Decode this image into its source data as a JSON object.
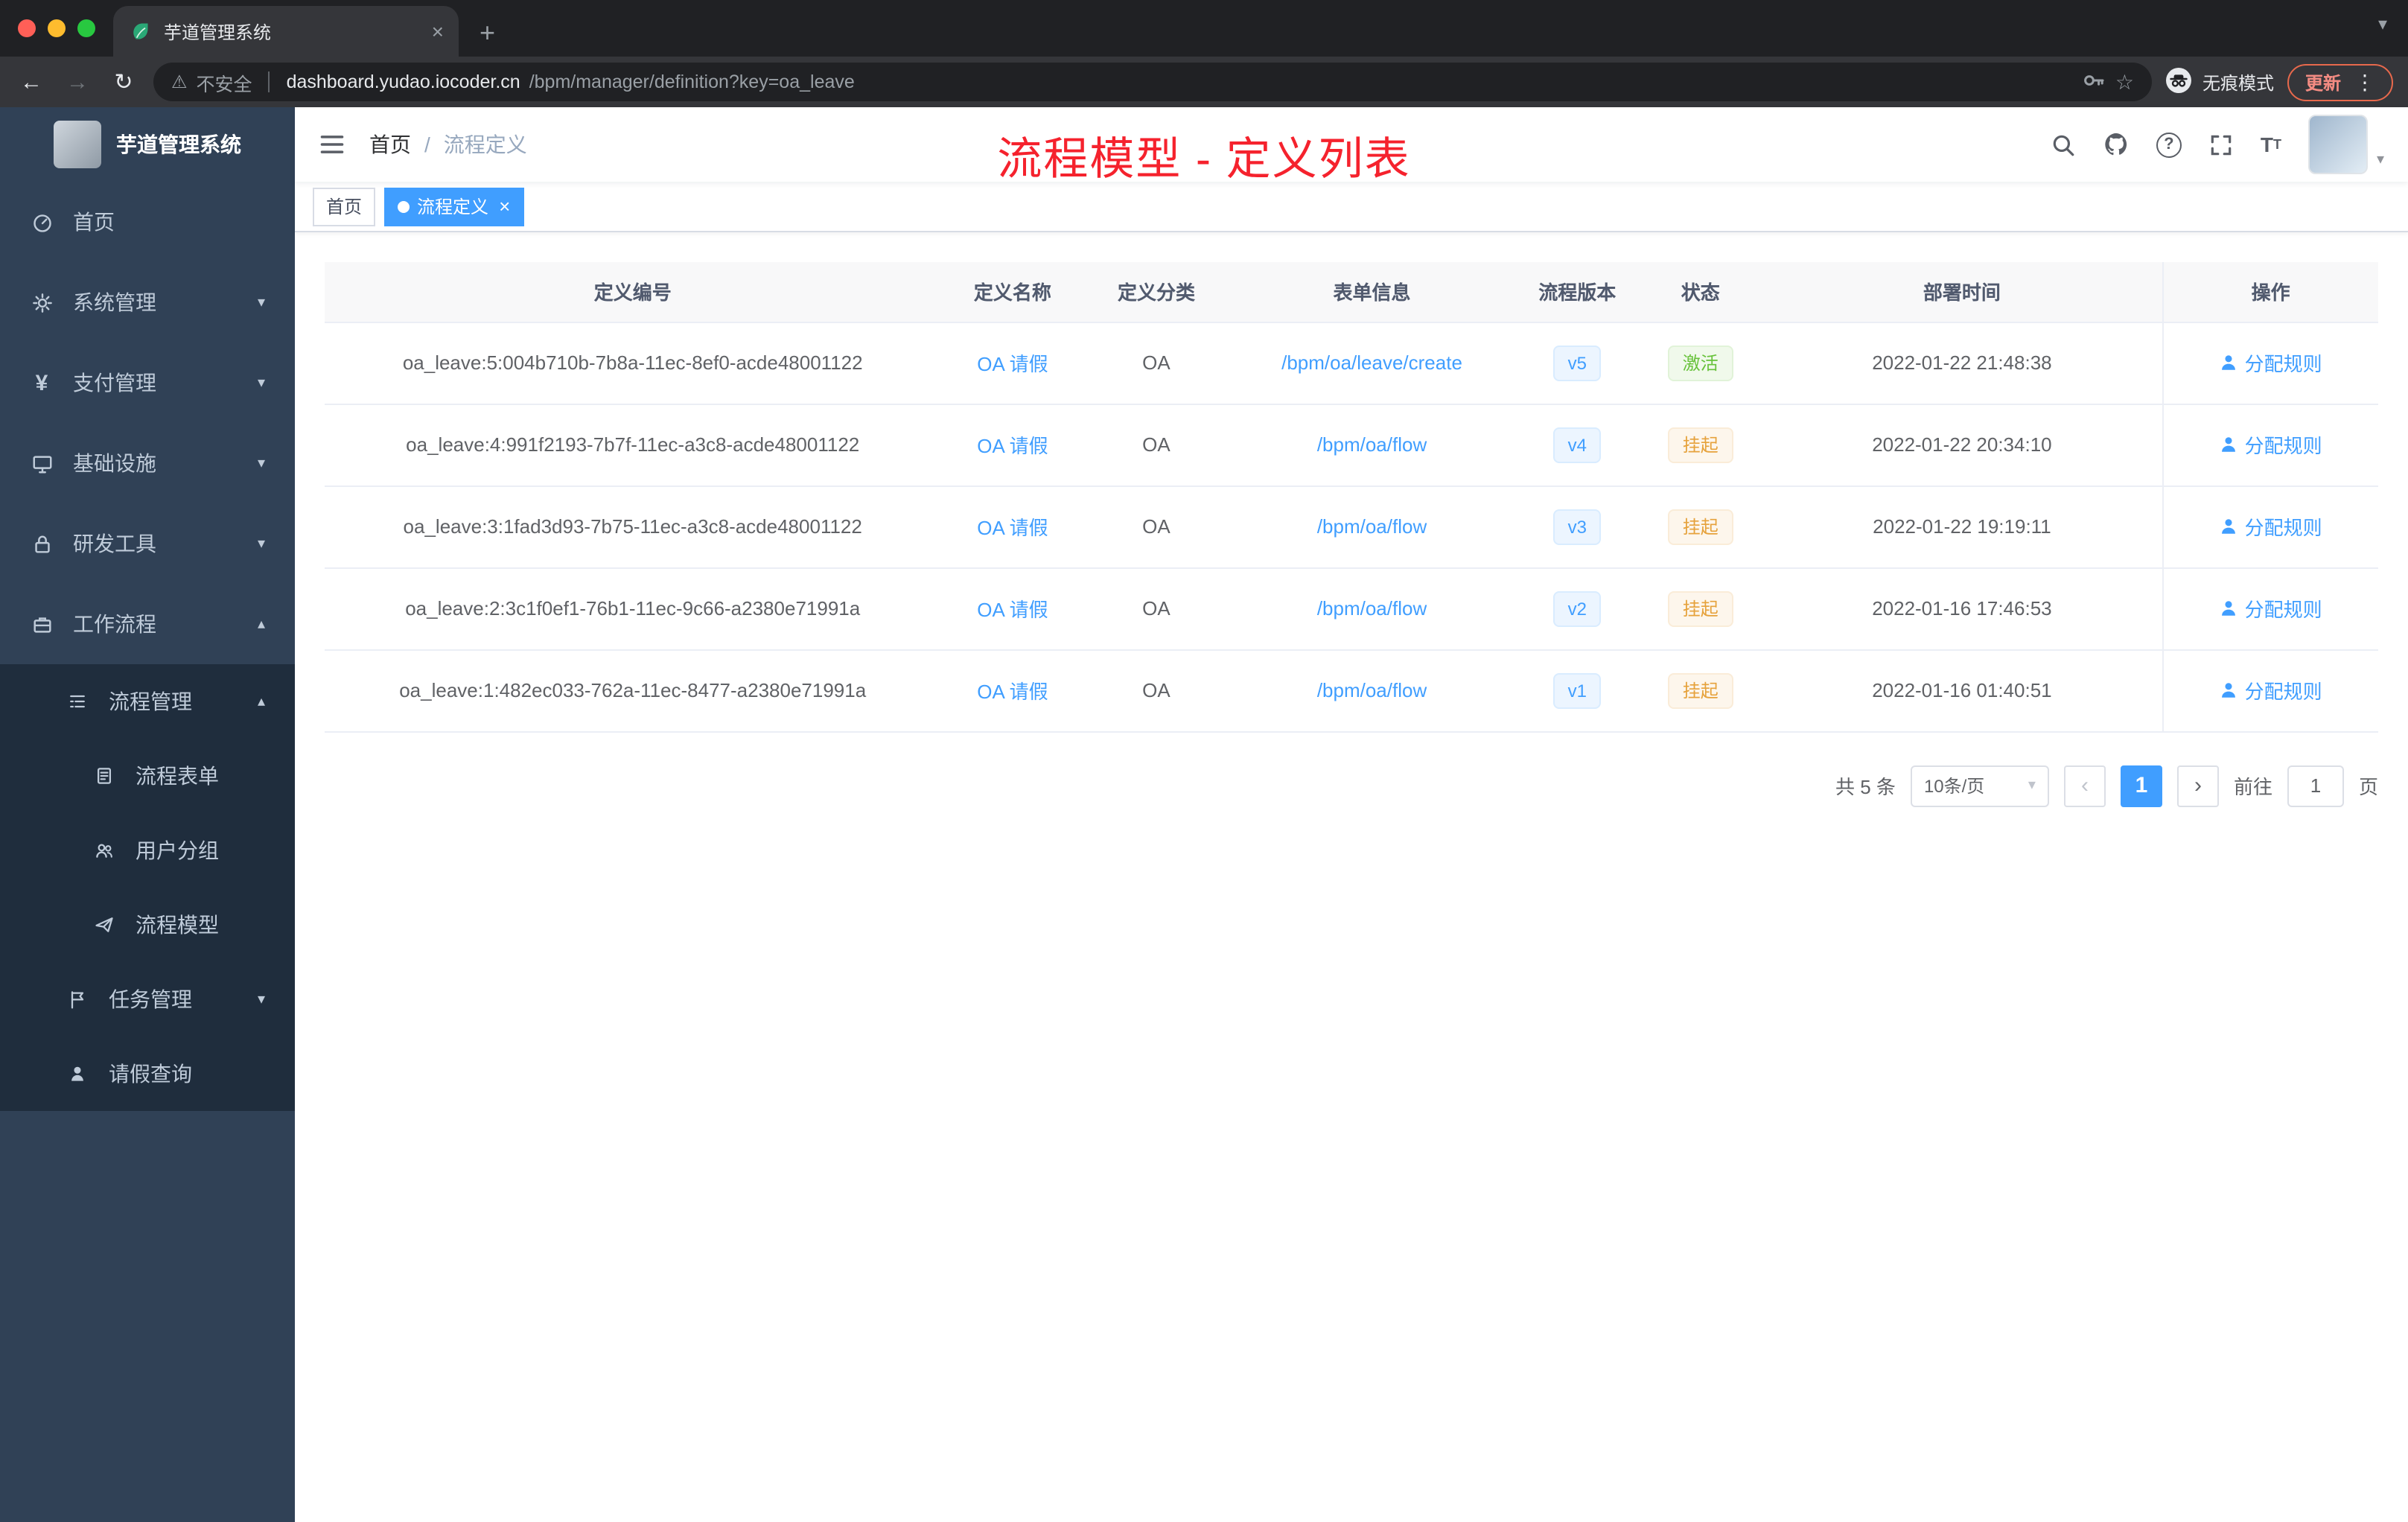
{
  "browser": {
    "tab_title": "芋道管理系统",
    "security_label": "不安全",
    "url_domain": "dashboard.yudao.iocoder.cn",
    "url_path": "/bpm/manager/definition?key=oa_leave",
    "incognito_label": "无痕模式",
    "update_label": "更新"
  },
  "glyphs": {
    "close": "×",
    "plus": "+",
    "back": "←",
    "forward": "→",
    "reload": "↻",
    "warning": "⚠",
    "star": "☆",
    "dots": "⋮",
    "caret_down": "▾",
    "caret_up": "▴",
    "question": "?",
    "prev": "‹",
    "next": "›",
    "divider": "/",
    "letter_t": "T",
    "yen": "¥"
  },
  "sidebar": {
    "logo_title": "芋道管理系统",
    "items": [
      {
        "label": "首页"
      },
      {
        "label": "系统管理"
      },
      {
        "label": "支付管理"
      },
      {
        "label": "基础设施"
      },
      {
        "label": "研发工具"
      },
      {
        "label": "工作流程"
      }
    ],
    "submenu": {
      "group_label": "流程管理",
      "children": [
        {
          "label": "流程表单"
        },
        {
          "label": "用户分组"
        },
        {
          "label": "流程模型"
        }
      ],
      "task_label": "任务管理",
      "leave_label": "请假查询"
    }
  },
  "header": {
    "breadcrumb_home": "首页",
    "breadcrumb_current": "流程定义",
    "annotation": "流程模型 - 定义列表"
  },
  "tags": [
    {
      "label": "首页"
    },
    {
      "label": "流程定义"
    }
  ],
  "table": {
    "columns": [
      "定义编号",
      "定义名称",
      "定义分类",
      "表单信息",
      "流程版本",
      "状态",
      "部署时间",
      "操作"
    ],
    "rows": [
      {
        "id": "oa_leave:5:004b710b-7b8a-11ec-8ef0-acde48001122",
        "name": "OA 请假",
        "category": "OA",
        "form": "/bpm/oa/leave/create",
        "version": "v5",
        "status": "激活",
        "time": "2022-01-22 21:48:38",
        "action": "分配规则"
      },
      {
        "id": "oa_leave:4:991f2193-7b7f-11ec-a3c8-acde48001122",
        "name": "OA 请假",
        "category": "OA",
        "form": "/bpm/oa/flow",
        "version": "v4",
        "status": "挂起",
        "time": "2022-01-22 20:34:10",
        "action": "分配规则"
      },
      {
        "id": "oa_leave:3:1fad3d93-7b75-11ec-a3c8-acde48001122",
        "name": "OA 请假",
        "category": "OA",
        "form": "/bpm/oa/flow",
        "version": "v3",
        "status": "挂起",
        "time": "2022-01-22 19:19:11",
        "action": "分配规则"
      },
      {
        "id": "oa_leave:2:3c1f0ef1-76b1-11ec-9c66-a2380e71991a",
        "name": "OA 请假",
        "category": "OA",
        "form": "/bpm/oa/flow",
        "version": "v2",
        "status": "挂起",
        "time": "2022-01-16 17:46:53",
        "action": "分配规则"
      },
      {
        "id": "oa_leave:1:482ec033-762a-11ec-8477-a2380e71991a",
        "name": "OA 请假",
        "category": "OA",
        "form": "/bpm/oa/flow",
        "version": "v1",
        "status": "挂起",
        "time": "2022-01-16 01:40:51",
        "action": "分配规则"
      }
    ]
  },
  "pagination": {
    "total": "共 5 条",
    "size": "10条/页",
    "page": "1",
    "goto_label": "前往",
    "goto_value": "1",
    "goto_suffix": "页"
  },
  "colors": {
    "primary": "#409eff",
    "success": "#67c23a",
    "warning": "#e6a23c",
    "annotation_red": "#f5222d",
    "active_tag": "#409eff"
  }
}
